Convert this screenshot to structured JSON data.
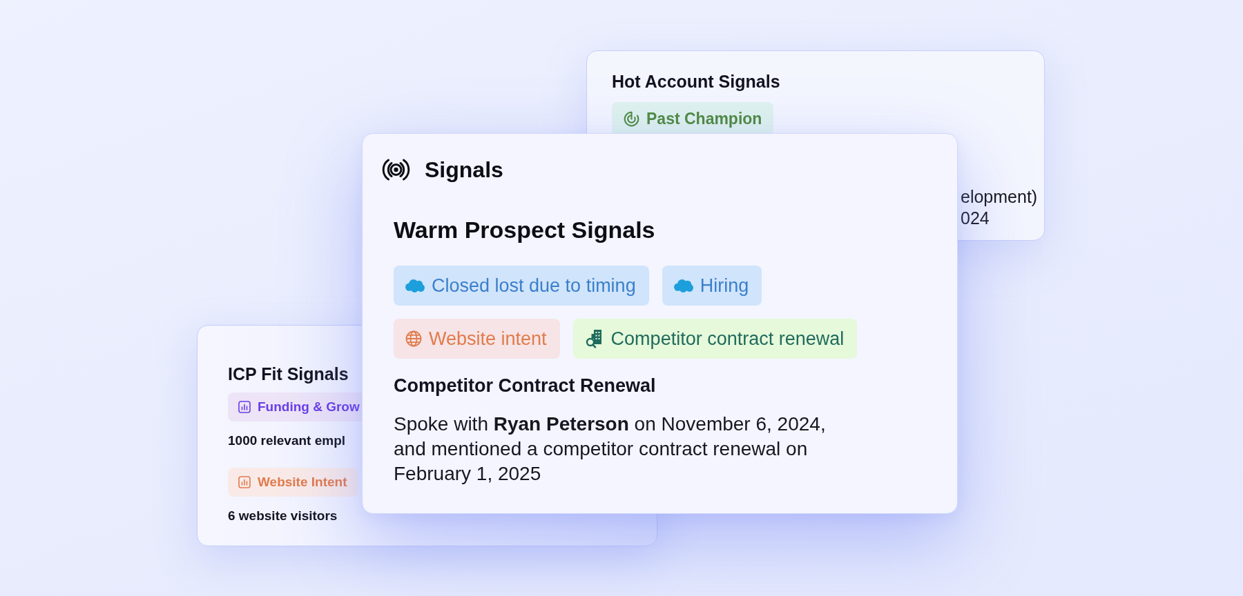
{
  "hot_account_card": {
    "title": "Hot Account Signals",
    "badge": {
      "label": "Past Champion",
      "kind": "champion",
      "color": "#4f8a3f"
    },
    "partial_lines": [
      "elopment)",
      "024"
    ]
  },
  "main_card": {
    "title": "Signals",
    "section_title": "Warm Prospect Signals",
    "badges": [
      {
        "label": "Closed lost due to timing",
        "kind": "crm",
        "color": "#3b7fcb"
      },
      {
        "label": "Hiring",
        "kind": "crm",
        "color": "#3b7fcb"
      },
      {
        "label": "Website intent",
        "kind": "web",
        "color": "#e27b4c"
      },
      {
        "label": "Competitor contract renewal",
        "kind": "competitor",
        "color": "#1f6b5d"
      }
    ],
    "detail_title": "Competitor Contract Renewal",
    "detail_text": "Spoke with **Ryan Peterson** on November 6, 2024, and mentioned a competitor contract renewal on February 1, 2025"
  },
  "icp_card": {
    "title": "ICP Fit Signals",
    "signals": [
      {
        "label": "Funding & Grow",
        "kind": "chart",
        "color": "#6a3ee6",
        "detail": "1000 relevant empl"
      },
      {
        "label": "Website Intent",
        "kind": "chart",
        "color": "#e27b4c",
        "detail": "6 website visitors"
      }
    ]
  }
}
